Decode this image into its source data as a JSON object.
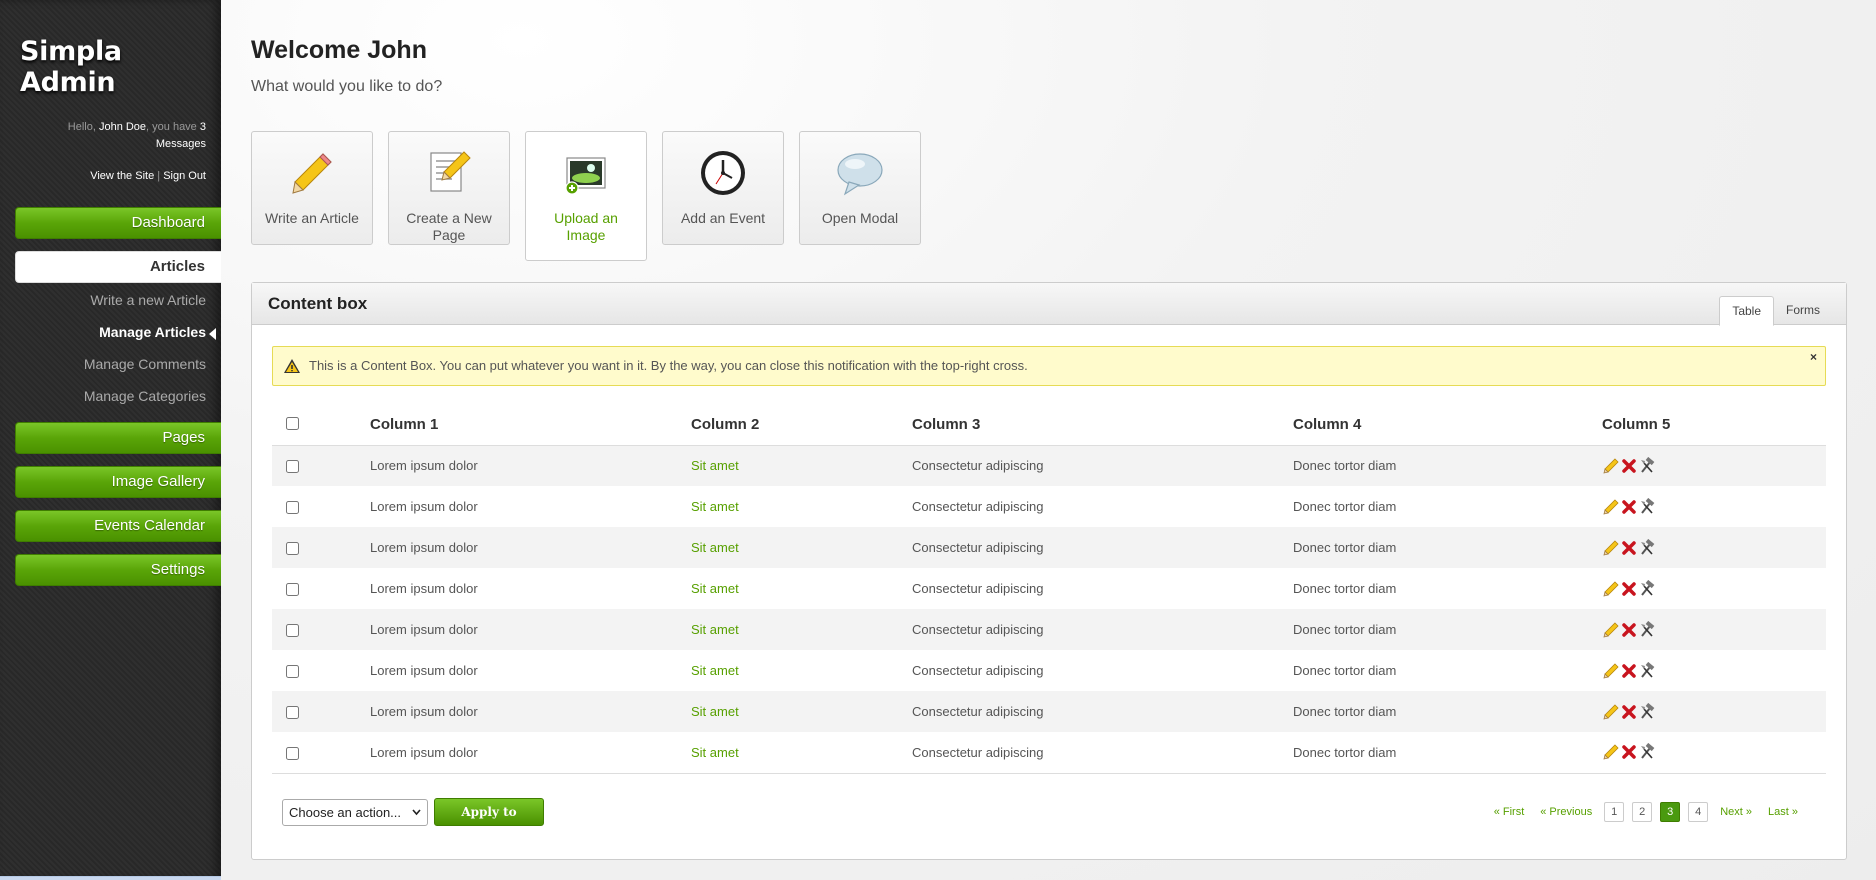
{
  "brand": "Simpla Admin",
  "profile": {
    "hello": "Hello,",
    "user": "John Doe",
    "you_have": ", you have",
    "count": "3",
    "messages": "Messages",
    "view_site": "View the Site",
    "separator": "|",
    "sign_out": "Sign Out"
  },
  "nav": {
    "dashboard": "Dashboard",
    "articles": "Articles",
    "sub": [
      "Write a new Article",
      "Manage Articles",
      "Manage Comments",
      "Manage Categories"
    ],
    "pages": "Pages",
    "gallery": "Image Gallery",
    "events": "Events Calendar",
    "settings": "Settings"
  },
  "header": {
    "title": "Welcome John",
    "subtitle": "What would you like to do?"
  },
  "shortcuts": [
    {
      "label": "Write an Article",
      "icon": "pencil-icon"
    },
    {
      "label": "Create a New Page",
      "icon": "document-pencil-icon"
    },
    {
      "label": "Upload an Image",
      "icon": "image-upload-icon"
    },
    {
      "label": "Add an Event",
      "icon": "clock-icon"
    },
    {
      "label": "Open Modal",
      "icon": "speech-bubble-icon"
    }
  ],
  "content_box": {
    "title": "Content box",
    "tabs": [
      "Table",
      "Forms"
    ],
    "notification": "This is a Content Box. You can put whatever you want in it. By the way, you can close this notification with the top-right cross.",
    "close": "×"
  },
  "table": {
    "columns": [
      "Column 1",
      "Column 2",
      "Column 3",
      "Column 4",
      "Column 5"
    ],
    "rows": [
      [
        "Lorem ipsum dolor",
        "Sit amet",
        "Consectetur adipiscing",
        "Donec tortor diam"
      ],
      [
        "Lorem ipsum dolor",
        "Sit amet",
        "Consectetur adipiscing",
        "Donec tortor diam"
      ],
      [
        "Lorem ipsum dolor",
        "Sit amet",
        "Consectetur adipiscing",
        "Donec tortor diam"
      ],
      [
        "Lorem ipsum dolor",
        "Sit amet",
        "Consectetur adipiscing",
        "Donec tortor diam"
      ],
      [
        "Lorem ipsum dolor",
        "Sit amet",
        "Consectetur adipiscing",
        "Donec tortor diam"
      ],
      [
        "Lorem ipsum dolor",
        "Sit amet",
        "Consectetur adipiscing",
        "Donec tortor diam"
      ],
      [
        "Lorem ipsum dolor",
        "Sit amet",
        "Consectetur adipiscing",
        "Donec tortor diam"
      ],
      [
        "Lorem ipsum dolor",
        "Sit amet",
        "Consectetur adipiscing",
        "Donec tortor diam"
      ]
    ]
  },
  "bulk": {
    "select": "Choose an action...",
    "apply": "Apply to selected"
  },
  "pagination": {
    "first": "« First",
    "previous": "« Previous",
    "pages": [
      "1",
      "2",
      "3",
      "4"
    ],
    "current": "3",
    "next": "Next »",
    "last": "Last »"
  },
  "colors": {
    "accent": "#57a000",
    "nav_green": "#5aa508",
    "notification_bg": "#fffbcc"
  }
}
